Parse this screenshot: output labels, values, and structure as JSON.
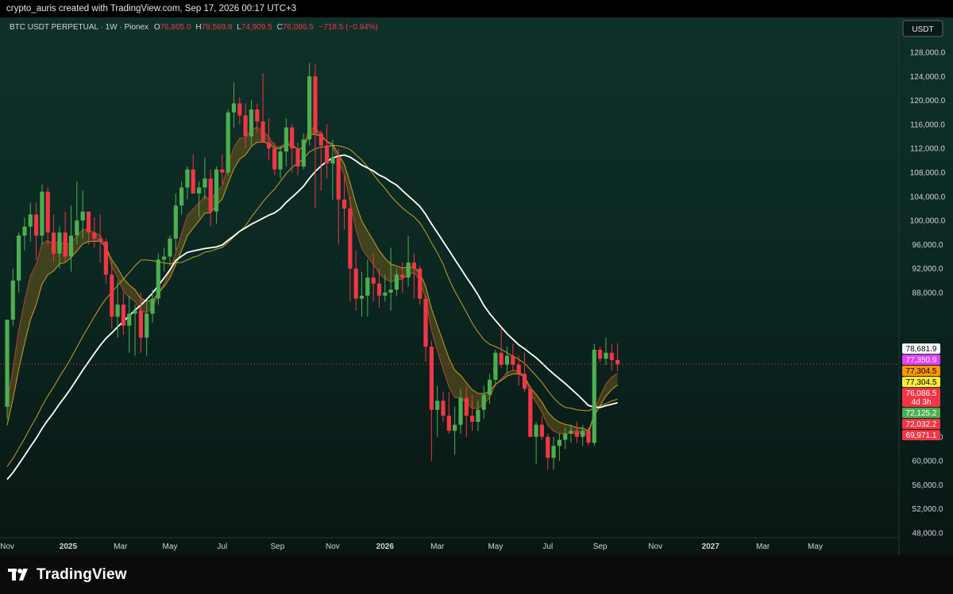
{
  "header": {
    "attribution": "crypto_auris created with TradingView.com, Sep 17, 2026 00:17 UTC+3"
  },
  "legend": {
    "symbol": "BTC USDT PERPETUAL · 1W · Pionex",
    "o_label": "O",
    "o_value": "76,805.0",
    "h_label": "H",
    "h_value": "79,569.8",
    "l_label": "L",
    "l_value": "74,909.5",
    "c_label": "C",
    "c_value": "76,086.5",
    "change": "−718.5 (−0.94%)"
  },
  "currency_button": "USDT",
  "brand": {
    "name": "TradingView"
  },
  "colors": {
    "up": "#4caf50",
    "down": "#f23645",
    "ma_white": "#ffffff",
    "ma_gold": "#c8a02a",
    "ribbon_fill": "#6b5a1c",
    "ribbon_edge": "#b5482f",
    "label_white": "#ffffff",
    "label_magenta": "#e040fb",
    "label_orange": "#ff9800",
    "label_yellow": "#ffeb3b",
    "label_red": "#f23645",
    "label_green": "#4caf50"
  },
  "chart_data": {
    "type": "candlestick",
    "timeframe": "1W",
    "ylim": [
      45000,
      131000
    ],
    "y_ticks": [
      "128,000.0",
      "124,000.0",
      "120,000.0",
      "116,000.0",
      "112,000.0",
      "108,000.0",
      "104,000.0",
      "100,000.0",
      "96,000.0",
      "92,000.0",
      "88,000.0",
      "64,000.0",
      "60,000.0",
      "56,000.0",
      "52,000.0",
      "48,000.0"
    ],
    "y_tick_values": [
      128000,
      124000,
      120000,
      116000,
      112000,
      108000,
      104000,
      100000,
      96000,
      92000,
      88000,
      64000,
      60000,
      56000,
      52000,
      48000
    ],
    "x_ticks": [
      "Nov",
      "2025",
      "Mar",
      "May",
      "Jul",
      "Sep",
      "Nov",
      "2026",
      "Mar",
      "May",
      "Jul",
      "Sep",
      "Nov",
      "2027",
      "Mar",
      "May"
    ],
    "x_tick_weeks": [
      0,
      10.5,
      19.5,
      28,
      37,
      46.5,
      56,
      65,
      74,
      84,
      93,
      102,
      111.5,
      121,
      130,
      139
    ],
    "x_bold": [
      "2025",
      "2026",
      "2027"
    ],
    "price_labels": [
      {
        "text": "78,681.9",
        "value": 78681.9,
        "color": "label_white"
      },
      {
        "text": "77,350.9",
        "value": 77350.9,
        "color": "label_magenta"
      },
      {
        "text": "77,304.5",
        "value": 77304.5,
        "color": "label_orange"
      },
      {
        "text": "77,304.5",
        "value": 77304.5,
        "color": "label_yellow"
      },
      {
        "text": "76,086.5",
        "value": 76086.5,
        "color": "label_red",
        "sub": "4d 3h"
      },
      {
        "text": "72,125.2",
        "value": 72125.2,
        "color": "label_green"
      },
      {
        "text": "72,032.2",
        "value": 72032.2,
        "color": "label_red"
      },
      {
        "text": "69,971.1",
        "value": 69971.1,
        "color": "label_red"
      }
    ],
    "last_price": 76086.5,
    "candles": [
      [
        69000,
        83000,
        67000,
        83500
      ],
      [
        83500,
        92000,
        82500,
        90000
      ],
      [
        90000,
        98000,
        88000,
        97500
      ],
      [
        97500,
        100500,
        95000,
        99000
      ],
      [
        99000,
        103000,
        96500,
        101000
      ],
      [
        101000,
        103000,
        93500,
        97500
      ],
      [
        97500,
        106000,
        96000,
        104800
      ],
      [
        104800,
        105500,
        96000,
        98000
      ],
      [
        98000,
        101000,
        93000,
        94500
      ],
      [
        94500,
        99000,
        92000,
        98000
      ],
      [
        98000,
        101500,
        93000,
        94000
      ],
      [
        94000,
        102500,
        91500,
        97500
      ],
      [
        97500,
        106500,
        96000,
        100000
      ],
      [
        100000,
        105000,
        97000,
        101500
      ],
      [
        101500,
        101500,
        96000,
        98000
      ],
      [
        98000,
        100500,
        95500,
        97000
      ],
      [
        97000,
        101000,
        93000,
        96500
      ],
      [
        96500,
        97000,
        89500,
        91000
      ],
      [
        91000,
        93000,
        82000,
        84000
      ],
      [
        84000,
        90000,
        80500,
        86000
      ],
      [
        86000,
        88000,
        81000,
        82500
      ],
      [
        82500,
        87500,
        78000,
        84500
      ],
      [
        84500,
        86000,
        77500,
        85000
      ],
      [
        85000,
        88000,
        78000,
        80500
      ],
      [
        80500,
        86500,
        77500,
        84500
      ],
      [
        84500,
        88500,
        83000,
        87000
      ],
      [
        87000,
        94500,
        86000,
        93500
      ],
      [
        93500,
        95500,
        91500,
        94000
      ],
      [
        94000,
        97500,
        92500,
        97000
      ],
      [
        97000,
        104500,
        95000,
        102500
      ],
      [
        102500,
        106500,
        101000,
        105500
      ],
      [
        105500,
        109000,
        103500,
        108500
      ],
      [
        108500,
        111000,
        104500,
        104500
      ],
      [
        104500,
        106500,
        100500,
        105500
      ],
      [
        105500,
        110500,
        103500,
        107000
      ],
      [
        107000,
        108500,
        99000,
        101500
      ],
      [
        101500,
        109000,
        99500,
        108500
      ],
      [
        108500,
        111000,
        106000,
        108000
      ],
      [
        108000,
        118500,
        107500,
        118000
      ],
      [
        118000,
        123000,
        115500,
        119500
      ],
      [
        119500,
        120500,
        116000,
        117500
      ],
      [
        117500,
        119500,
        112000,
        114000
      ],
      [
        114000,
        120000,
        112500,
        118500
      ],
      [
        118500,
        119500,
        114500,
        116500
      ],
      [
        116500,
        124500,
        115000,
        113000
      ],
      [
        113000,
        117000,
        110000,
        112000
      ],
      [
        112000,
        113000,
        107500,
        108500
      ],
      [
        108500,
        112500,
        107000,
        111500
      ],
      [
        111500,
        117000,
        109000,
        115500
      ],
      [
        115500,
        116000,
        108000,
        112000
      ],
      [
        112000,
        113000,
        107500,
        109000
      ],
      [
        109000,
        114500,
        108500,
        113500
      ],
      [
        113500,
        126200,
        112500,
        124000
      ],
      [
        124000,
        126000,
        102000,
        114500
      ],
      [
        114500,
        115000,
        105000,
        112500
      ],
      [
        112500,
        116000,
        107000,
        109500
      ],
      [
        109500,
        113500,
        103500,
        110500
      ],
      [
        110500,
        112000,
        96000,
        103500
      ],
      [
        103500,
        107500,
        98500,
        102000
      ],
      [
        102000,
        104000,
        86500,
        92000
      ],
      [
        92000,
        95000,
        85000,
        87000
      ],
      [
        87000,
        91500,
        84000,
        87500
      ],
      [
        87500,
        93500,
        84000,
        90500
      ],
      [
        90500,
        94500,
        86500,
        89500
      ],
      [
        89500,
        92000,
        85500,
        87500
      ],
      [
        87500,
        91000,
        86500,
        88000
      ],
      [
        88000,
        95500,
        85000,
        88500
      ],
      [
        88500,
        92000,
        87500,
        91000
      ],
      [
        91000,
        93000,
        88000,
        90500
      ],
      [
        90500,
        97500,
        89000,
        93000
      ],
      [
        93000,
        94500,
        87000,
        92000
      ],
      [
        92000,
        92500,
        86000,
        87000
      ],
      [
        87000,
        87500,
        76500,
        79000
      ],
      [
        79000,
        80000,
        60000,
        68500
      ],
      [
        68500,
        72500,
        64000,
        70000
      ],
      [
        70000,
        71500,
        66500,
        67500
      ],
      [
        67500,
        71500,
        64500,
        65000
      ],
      [
        65000,
        69000,
        61000,
        66000
      ],
      [
        66000,
        72000,
        64500,
        70500
      ],
      [
        70500,
        72500,
        64000,
        67500
      ],
      [
        67500,
        71000,
        65000,
        66500
      ],
      [
        66500,
        70000,
        65000,
        68500
      ],
      [
        68500,
        72500,
        67000,
        71000
      ],
      [
        71000,
        74500,
        69500,
        73500
      ],
      [
        73500,
        78500,
        72500,
        78000
      ],
      [
        78000,
        82000,
        75500,
        76000
      ],
      [
        76000,
        79000,
        74500,
        77500
      ],
      [
        77500,
        79500,
        75000,
        76000
      ],
      [
        76000,
        77500,
        72500,
        74500
      ],
      [
        74500,
        78000,
        71500,
        72000
      ],
      [
        72000,
        72500,
        64000,
        64000
      ],
      [
        64000,
        66500,
        59500,
        66000
      ],
      [
        66000,
        67500,
        63500,
        64000
      ],
      [
        64000,
        64500,
        58500,
        60500
      ],
      [
        60500,
        64000,
        58500,
        62500
      ],
      [
        62500,
        64500,
        60000,
        63500
      ],
      [
        63500,
        65500,
        62000,
        64500
      ],
      [
        64500,
        66000,
        63000,
        65000
      ],
      [
        65000,
        66500,
        63000,
        64000
      ],
      [
        64000,
        66000,
        62500,
        65000
      ],
      [
        65000,
        65500,
        62500,
        63000
      ],
      [
        63000,
        79500,
        62500,
        78500
      ],
      [
        78500,
        79000,
        76500,
        77000
      ],
      [
        77000,
        80500,
        76000,
        78000
      ],
      [
        78000,
        79500,
        75000,
        76800
      ],
      [
        76805,
        79569.8,
        74909.5,
        76086.5
      ]
    ]
  }
}
